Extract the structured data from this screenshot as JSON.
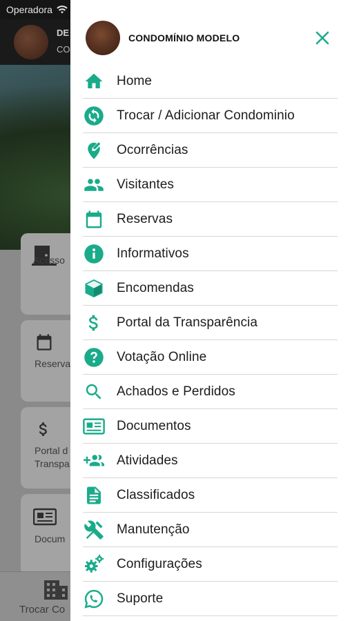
{
  "status_bar": {
    "carrier": "Operadora"
  },
  "background": {
    "header_name": "DE",
    "header_sub": "CO",
    "cards": [
      {
        "icon": "door-icon",
        "label": "Acesso"
      },
      {
        "icon": "calendar-icon",
        "label": "Reserva"
      },
      {
        "icon": "dollar-icon",
        "label_line1": "Portal d",
        "label_line2": "Transpa"
      },
      {
        "icon": "newspaper-icon",
        "label": "Docum"
      }
    ],
    "bottom_tab": "Trocar Co"
  },
  "drawer": {
    "condo_name": "CONDOMÍNIO MODELO",
    "accent_color": "#1aab8a",
    "menu": [
      {
        "label": "Home",
        "icon": "home-icon"
      },
      {
        "label": "Trocar / Adicionar Condominio",
        "icon": "swap-icon"
      },
      {
        "label": "Ocorrências",
        "icon": "edit-location-icon"
      },
      {
        "label": "Visitantes",
        "icon": "people-icon"
      },
      {
        "label": "Reservas",
        "icon": "calendar-icon"
      },
      {
        "label": "Informativos",
        "icon": "info-icon"
      },
      {
        "label": "Encomendas",
        "icon": "package-icon"
      },
      {
        "label": "Portal da Transparência",
        "icon": "dollar-icon"
      },
      {
        "label": "Votação Online",
        "icon": "help-icon"
      },
      {
        "label": "Achados e Perdidos",
        "icon": "search-icon"
      },
      {
        "label": "Documentos",
        "icon": "newspaper-icon"
      },
      {
        "label": "Atividades",
        "icon": "group-add-icon"
      },
      {
        "label": "Classificados",
        "icon": "document-icon"
      },
      {
        "label": "Manutenção",
        "icon": "tools-icon"
      },
      {
        "label": "Configurações",
        "icon": "gears-icon"
      },
      {
        "label": "Suporte",
        "icon": "whatsapp-icon"
      }
    ]
  }
}
